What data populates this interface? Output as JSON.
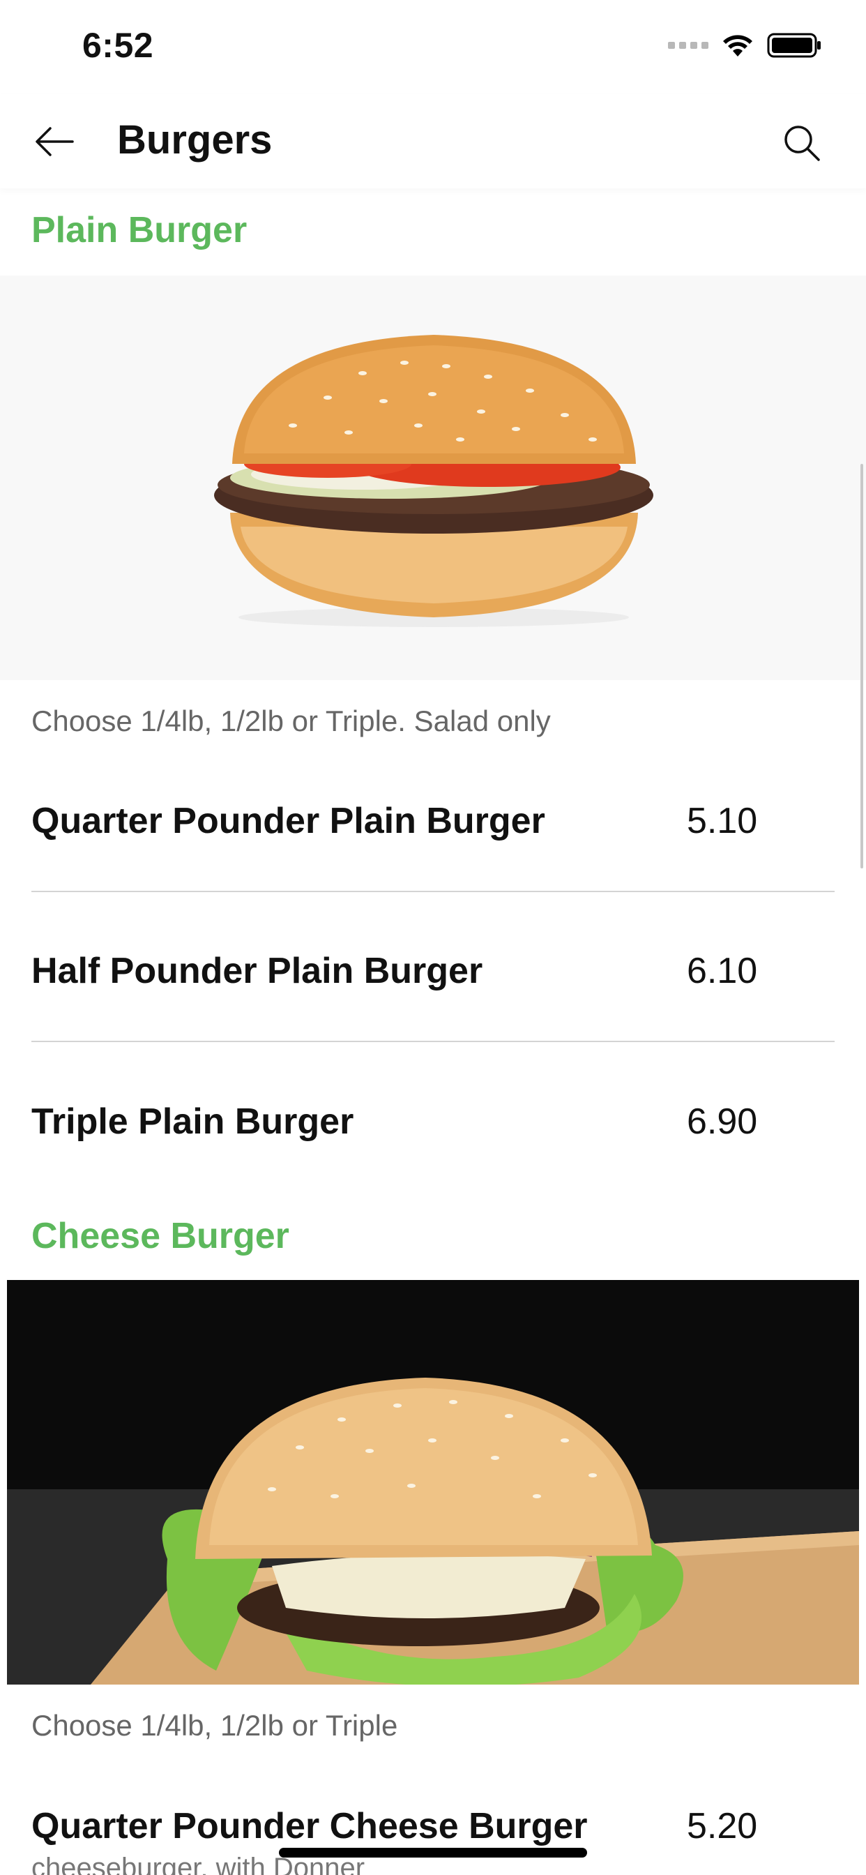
{
  "status_bar": {
    "time": "6:52",
    "icons": [
      "cellular-signal-icon",
      "wifi-icon",
      "battery-icon"
    ]
  },
  "header": {
    "title": "Burgers",
    "back_icon": "arrow-left-icon",
    "search_icon": "search-icon"
  },
  "colors": {
    "section_title": "#5cb85c",
    "text_primary": "#111111",
    "text_secondary": "#666666",
    "divider": "#d4d4d4"
  },
  "sections": [
    {
      "title": "Plain Burger",
      "description": "Choose 1/4lb, 1/2lb or Triple. Salad only",
      "items": [
        {
          "name": "Quarter Pounder Plain Burger",
          "price": "5.10"
        },
        {
          "name": "Half Pounder Plain Burger",
          "price": "6.10"
        },
        {
          "name": "Triple Plain Burger",
          "price": "6.90"
        }
      ]
    },
    {
      "title": "Cheese Burger",
      "description": "Choose 1/4lb, 1/2lb or Triple",
      "items": [
        {
          "name": "Quarter Pounder Cheese Burger",
          "price": "5.20",
          "subtitle": "cheeseburger, with Donner"
        }
      ]
    }
  ]
}
